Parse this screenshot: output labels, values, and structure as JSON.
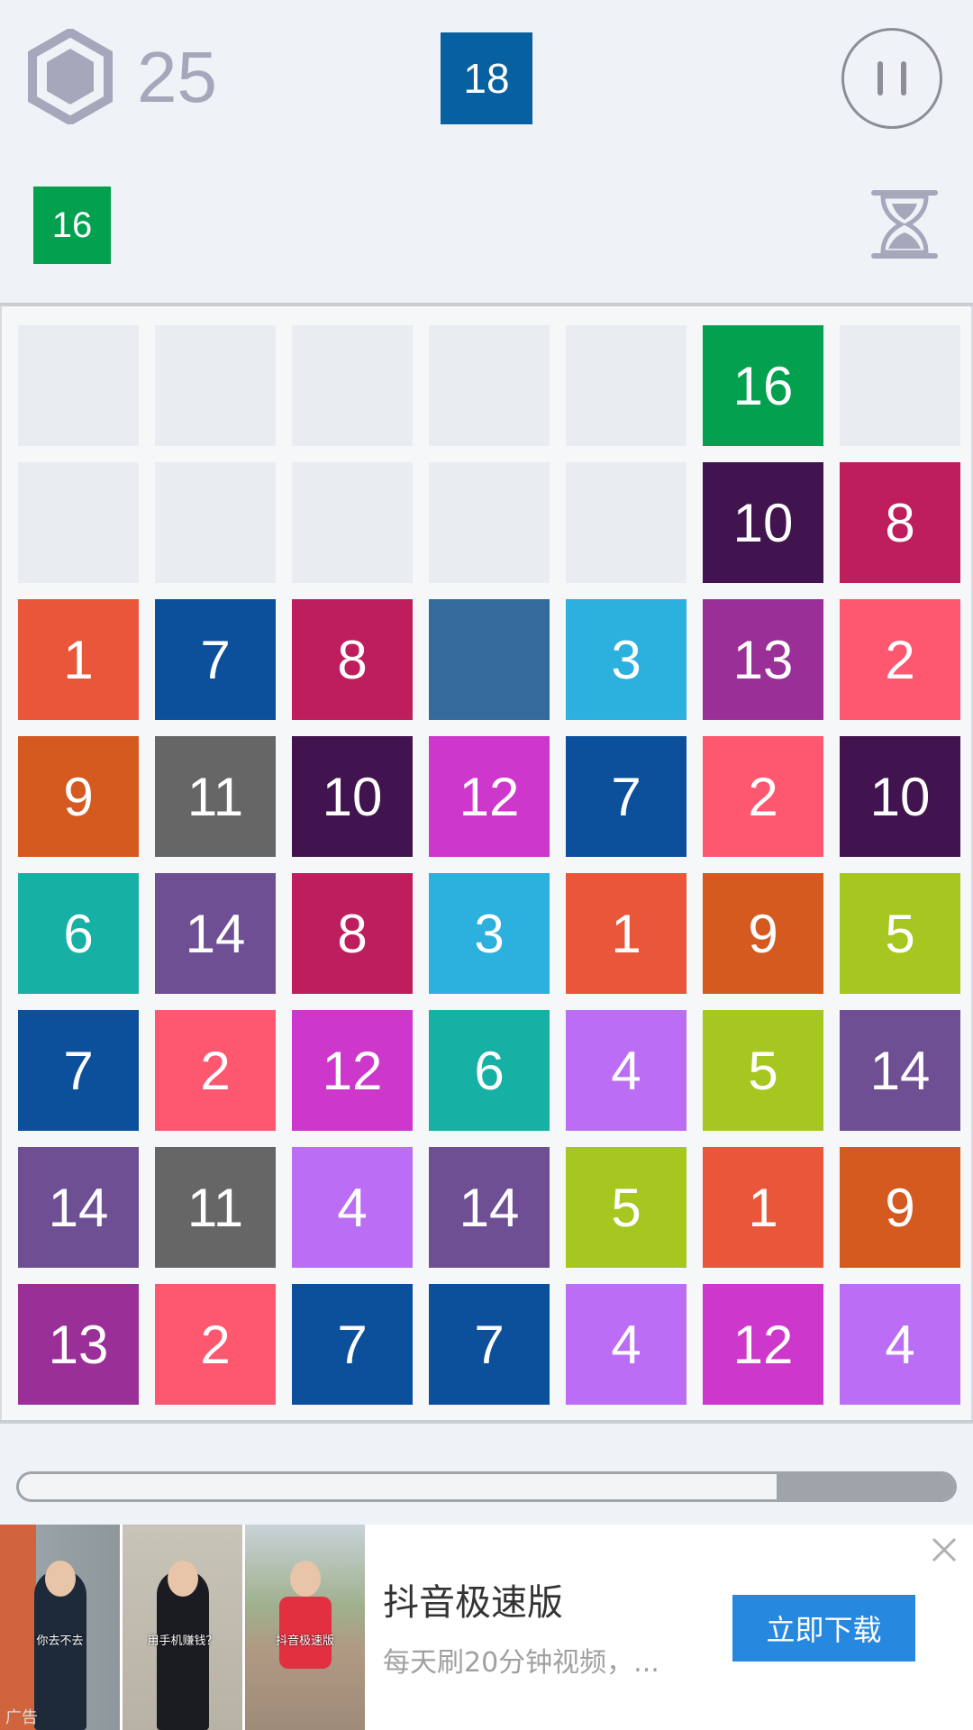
{
  "hud": {
    "score": "25",
    "next_tile": {
      "value": "18",
      "color": "#07609f"
    },
    "hold_tile": {
      "value": "16",
      "color": "#03a04f"
    },
    "icons": [
      "hexagon-icon",
      "pause-icon",
      "hourglass-icon"
    ]
  },
  "colors": {
    "1": "#e9563a",
    "2": "#fe5870",
    "3": "#2cb0de",
    "4": "#bb6ef5",
    "5": "#a6c720",
    "6": "#17b0a4",
    "7": "#0c4f9a",
    "8": "#be1e5e",
    "9": "#d45a20",
    "10": "#41144f",
    "11": "#666666",
    "12": "#cd37cc",
    "13": "#9a3097",
    "14": "#6e4f93",
    "16": "#03a04f",
    "blank": "#356a9d"
  },
  "board": {
    "rows": [
      [
        "",
        "",
        "",
        "",
        "",
        "16",
        ""
      ],
      [
        "",
        "",
        "",
        "",
        "",
        "10",
        "8"
      ],
      [
        "1",
        "7",
        "8",
        "blank",
        "3",
        "13",
        "2"
      ],
      [
        "9",
        "11",
        "10",
        "12",
        "7",
        "2",
        "10"
      ],
      [
        "6",
        "14",
        "8",
        "3",
        "1",
        "9",
        "5"
      ],
      [
        "7",
        "2",
        "12",
        "6",
        "4",
        "5",
        "14"
      ],
      [
        "14",
        "11",
        "4",
        "14",
        "5",
        "1",
        "9"
      ],
      [
        "13",
        "2",
        "7",
        "7",
        "4",
        "12",
        "4"
      ]
    ]
  },
  "progress": {
    "remaining_fraction": 0.19
  },
  "ad": {
    "title": "抖音极速版",
    "subtitle": "每天刷20分钟视频，...",
    "button_label": "立即下载",
    "ad_label": "广告",
    "thumb_captions": [
      "你去不去",
      "用手机赚钱？",
      "抖音极速版"
    ]
  }
}
